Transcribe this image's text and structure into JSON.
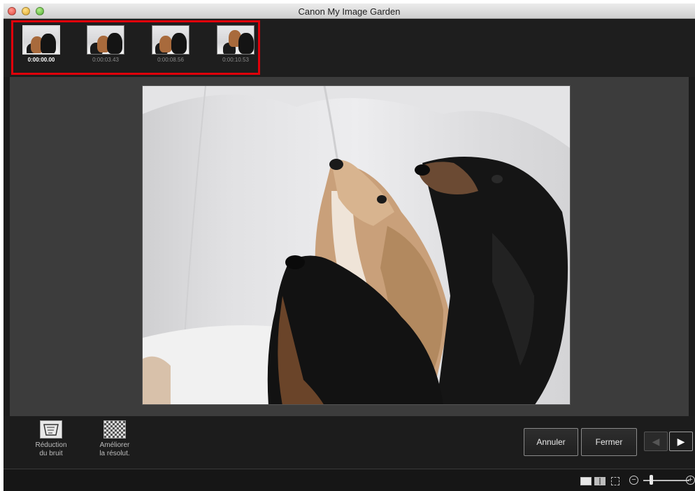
{
  "window": {
    "title": "Canon My Image Garden"
  },
  "thumbnails": [
    {
      "time": "0:00:00.00",
      "selected": true
    },
    {
      "time": "0:00:03.43",
      "selected": false
    },
    {
      "time": "0:00:08.56",
      "selected": false
    },
    {
      "time": "0:00:10.53",
      "selected": false
    }
  ],
  "tools": {
    "noise_reduction": {
      "line1": "Réduction",
      "line2": "du bruit",
      "icon": "noise-reduction-icon"
    },
    "improve_resolution": {
      "line1": "Améliorer",
      "line2": "la résolut.",
      "icon": "resolution-icon"
    }
  },
  "buttons": {
    "cancel": "Annuler",
    "close": "Fermer"
  },
  "navigation": {
    "prev_icon": "◀",
    "next_icon": "▶"
  },
  "zoom": {
    "minus": "−",
    "plus": "+"
  },
  "colors": {
    "highlight": "#e0000a",
    "background": "#1b1b1b",
    "preview_bg": "#3c3c3c"
  }
}
